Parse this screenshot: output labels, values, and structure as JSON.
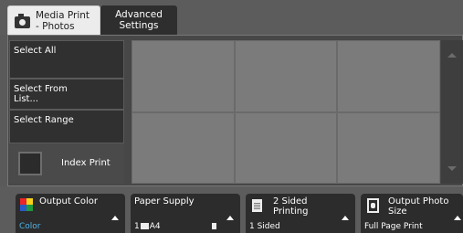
{
  "tabs": [
    {
      "label": "Media Print\n- Photos",
      "active": true
    },
    {
      "label": "Advanced\nSettings",
      "active": false
    }
  ],
  "side_buttons": {
    "select_all": "Select All",
    "select_from_list": "Select From\nList...",
    "select_range": "Select Range"
  },
  "index_print": {
    "label": "Index Print",
    "checked": false
  },
  "thumbnail_grid": {
    "rows": 2,
    "cols": 3
  },
  "features": {
    "output_color": {
      "title": "Output Color",
      "value": "Color"
    },
    "paper_supply": {
      "title": "Paper Supply",
      "tray": "1",
      "size": "A4"
    },
    "two_sided": {
      "title": "2 Sided\nPrinting",
      "value": "1 Sided"
    },
    "output_photo_size": {
      "title": "Output Photo\nSize",
      "value": "Full Page Print"
    }
  },
  "colors": {
    "background": "#5a5a5a",
    "button_dark": "#2c2c2c",
    "accent_blue": "#4fb3e8",
    "thumbnail": "#7b7b7b"
  }
}
